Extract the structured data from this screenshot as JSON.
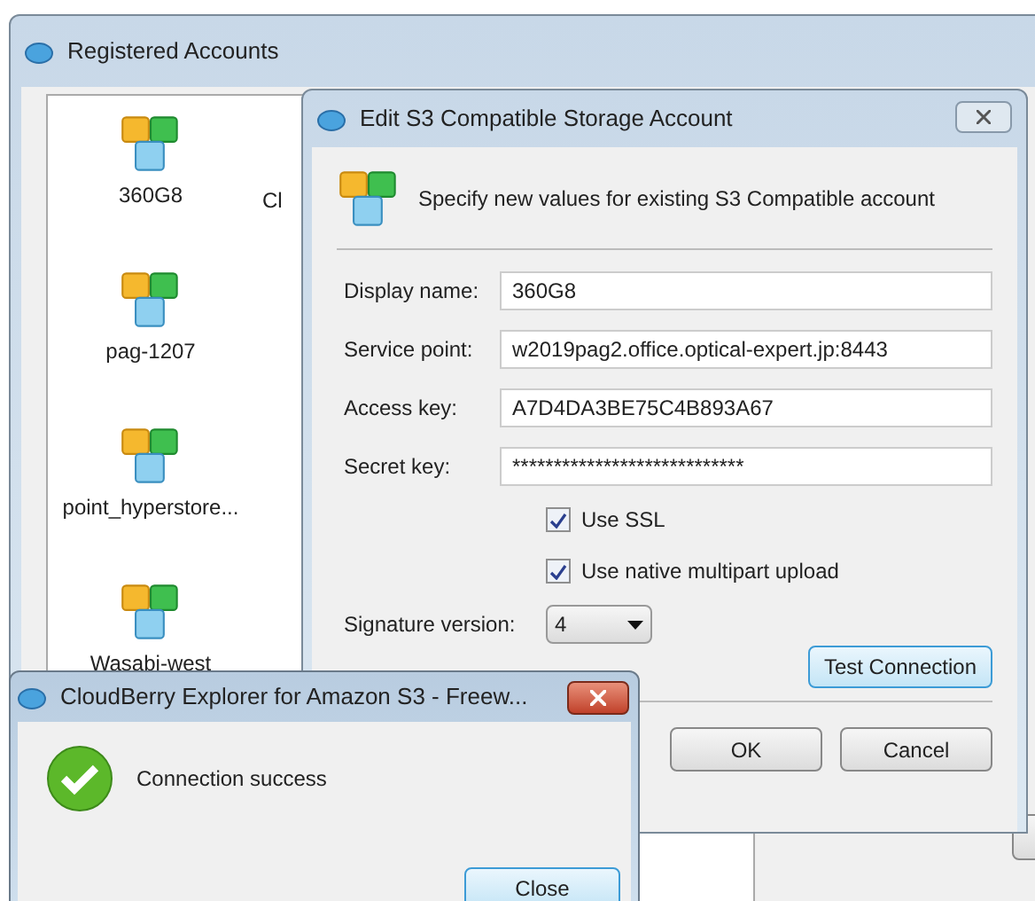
{
  "main_window": {
    "title": "Registered Accounts",
    "accounts": [
      {
        "name": "360G8",
        "selected": false
      },
      {
        "name": "pag-1207",
        "selected": false
      },
      {
        "name": "point_hyperstore...",
        "selected": false
      },
      {
        "name": "Wasabi-west",
        "selected": false
      }
    ],
    "column_2_partial": "Cl"
  },
  "edit_dialog": {
    "title": "Edit S3 Compatible Storage Account",
    "header": "Specify new values for existing S3 Compatible account",
    "fields": [
      {
        "label": "Display name:",
        "value": "360G8"
      },
      {
        "label": "Service point:",
        "value": "w2019pag2.office.optical-expert.jp:8443"
      },
      {
        "label": "Access key:",
        "value": "A7D4DA3BE75C4B893A67"
      },
      {
        "label": "Secret key:",
        "value": "****************************"
      }
    ],
    "options": [
      {
        "label": "Use SSL",
        "checked": true
      },
      {
        "label": "Use native multipart upload",
        "checked": true
      }
    ],
    "signature": {
      "label": "Signature version:",
      "value": "4"
    },
    "test_button": "Test Connection",
    "buttons": [
      "OK",
      "Cancel"
    ]
  },
  "message_box": {
    "title": "CloudBerry Explorer for Amazon S3 - Freew...",
    "message": "Connection success",
    "button": "Close"
  }
}
